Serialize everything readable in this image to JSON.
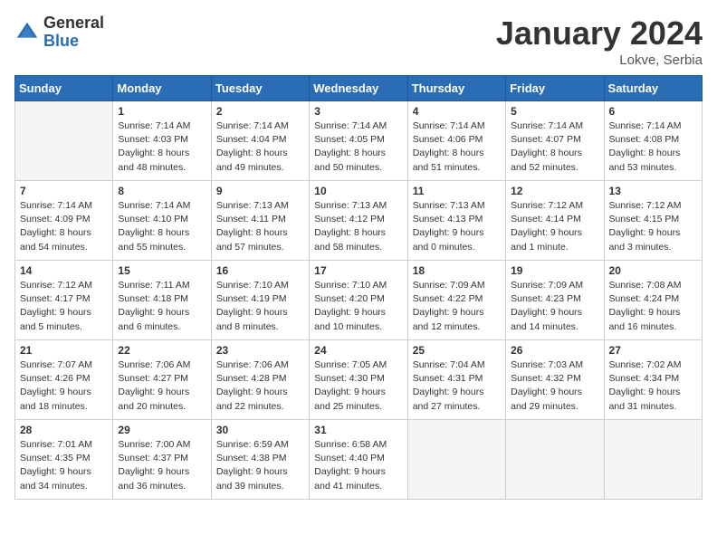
{
  "header": {
    "logo_general": "General",
    "logo_blue": "Blue",
    "title": "January 2024",
    "location": "Lokve, Serbia"
  },
  "days_of_week": [
    "Sunday",
    "Monday",
    "Tuesday",
    "Wednesday",
    "Thursday",
    "Friday",
    "Saturday"
  ],
  "weeks": [
    [
      {
        "day": "",
        "info": []
      },
      {
        "day": "1",
        "info": [
          "Sunrise: 7:14 AM",
          "Sunset: 4:03 PM",
          "Daylight: 8 hours",
          "and 48 minutes."
        ]
      },
      {
        "day": "2",
        "info": [
          "Sunrise: 7:14 AM",
          "Sunset: 4:04 PM",
          "Daylight: 8 hours",
          "and 49 minutes."
        ]
      },
      {
        "day": "3",
        "info": [
          "Sunrise: 7:14 AM",
          "Sunset: 4:05 PM",
          "Daylight: 8 hours",
          "and 50 minutes."
        ]
      },
      {
        "day": "4",
        "info": [
          "Sunrise: 7:14 AM",
          "Sunset: 4:06 PM",
          "Daylight: 8 hours",
          "and 51 minutes."
        ]
      },
      {
        "day": "5",
        "info": [
          "Sunrise: 7:14 AM",
          "Sunset: 4:07 PM",
          "Daylight: 8 hours",
          "and 52 minutes."
        ]
      },
      {
        "day": "6",
        "info": [
          "Sunrise: 7:14 AM",
          "Sunset: 4:08 PM",
          "Daylight: 8 hours",
          "and 53 minutes."
        ]
      }
    ],
    [
      {
        "day": "7",
        "info": [
          "Sunrise: 7:14 AM",
          "Sunset: 4:09 PM",
          "Daylight: 8 hours",
          "and 54 minutes."
        ]
      },
      {
        "day": "8",
        "info": [
          "Sunrise: 7:14 AM",
          "Sunset: 4:10 PM",
          "Daylight: 8 hours",
          "and 55 minutes."
        ]
      },
      {
        "day": "9",
        "info": [
          "Sunrise: 7:13 AM",
          "Sunset: 4:11 PM",
          "Daylight: 8 hours",
          "and 57 minutes."
        ]
      },
      {
        "day": "10",
        "info": [
          "Sunrise: 7:13 AM",
          "Sunset: 4:12 PM",
          "Daylight: 8 hours",
          "and 58 minutes."
        ]
      },
      {
        "day": "11",
        "info": [
          "Sunrise: 7:13 AM",
          "Sunset: 4:13 PM",
          "Daylight: 9 hours",
          "and 0 minutes."
        ]
      },
      {
        "day": "12",
        "info": [
          "Sunrise: 7:12 AM",
          "Sunset: 4:14 PM",
          "Daylight: 9 hours",
          "and 1 minute."
        ]
      },
      {
        "day": "13",
        "info": [
          "Sunrise: 7:12 AM",
          "Sunset: 4:15 PM",
          "Daylight: 9 hours",
          "and 3 minutes."
        ]
      }
    ],
    [
      {
        "day": "14",
        "info": [
          "Sunrise: 7:12 AM",
          "Sunset: 4:17 PM",
          "Daylight: 9 hours",
          "and 5 minutes."
        ]
      },
      {
        "day": "15",
        "info": [
          "Sunrise: 7:11 AM",
          "Sunset: 4:18 PM",
          "Daylight: 9 hours",
          "and 6 minutes."
        ]
      },
      {
        "day": "16",
        "info": [
          "Sunrise: 7:10 AM",
          "Sunset: 4:19 PM",
          "Daylight: 9 hours",
          "and 8 minutes."
        ]
      },
      {
        "day": "17",
        "info": [
          "Sunrise: 7:10 AM",
          "Sunset: 4:20 PM",
          "Daylight: 9 hours",
          "and 10 minutes."
        ]
      },
      {
        "day": "18",
        "info": [
          "Sunrise: 7:09 AM",
          "Sunset: 4:22 PM",
          "Daylight: 9 hours",
          "and 12 minutes."
        ]
      },
      {
        "day": "19",
        "info": [
          "Sunrise: 7:09 AM",
          "Sunset: 4:23 PM",
          "Daylight: 9 hours",
          "and 14 minutes."
        ]
      },
      {
        "day": "20",
        "info": [
          "Sunrise: 7:08 AM",
          "Sunset: 4:24 PM",
          "Daylight: 9 hours",
          "and 16 minutes."
        ]
      }
    ],
    [
      {
        "day": "21",
        "info": [
          "Sunrise: 7:07 AM",
          "Sunset: 4:26 PM",
          "Daylight: 9 hours",
          "and 18 minutes."
        ]
      },
      {
        "day": "22",
        "info": [
          "Sunrise: 7:06 AM",
          "Sunset: 4:27 PM",
          "Daylight: 9 hours",
          "and 20 minutes."
        ]
      },
      {
        "day": "23",
        "info": [
          "Sunrise: 7:06 AM",
          "Sunset: 4:28 PM",
          "Daylight: 9 hours",
          "and 22 minutes."
        ]
      },
      {
        "day": "24",
        "info": [
          "Sunrise: 7:05 AM",
          "Sunset: 4:30 PM",
          "Daylight: 9 hours",
          "and 25 minutes."
        ]
      },
      {
        "day": "25",
        "info": [
          "Sunrise: 7:04 AM",
          "Sunset: 4:31 PM",
          "Daylight: 9 hours",
          "and 27 minutes."
        ]
      },
      {
        "day": "26",
        "info": [
          "Sunrise: 7:03 AM",
          "Sunset: 4:32 PM",
          "Daylight: 9 hours",
          "and 29 minutes."
        ]
      },
      {
        "day": "27",
        "info": [
          "Sunrise: 7:02 AM",
          "Sunset: 4:34 PM",
          "Daylight: 9 hours",
          "and 31 minutes."
        ]
      }
    ],
    [
      {
        "day": "28",
        "info": [
          "Sunrise: 7:01 AM",
          "Sunset: 4:35 PM",
          "Daylight: 9 hours",
          "and 34 minutes."
        ]
      },
      {
        "day": "29",
        "info": [
          "Sunrise: 7:00 AM",
          "Sunset: 4:37 PM",
          "Daylight: 9 hours",
          "and 36 minutes."
        ]
      },
      {
        "day": "30",
        "info": [
          "Sunrise: 6:59 AM",
          "Sunset: 4:38 PM",
          "Daylight: 9 hours",
          "and 39 minutes."
        ]
      },
      {
        "day": "31",
        "info": [
          "Sunrise: 6:58 AM",
          "Sunset: 4:40 PM",
          "Daylight: 9 hours",
          "and 41 minutes."
        ]
      },
      {
        "day": "",
        "info": []
      },
      {
        "day": "",
        "info": []
      },
      {
        "day": "",
        "info": []
      }
    ]
  ]
}
